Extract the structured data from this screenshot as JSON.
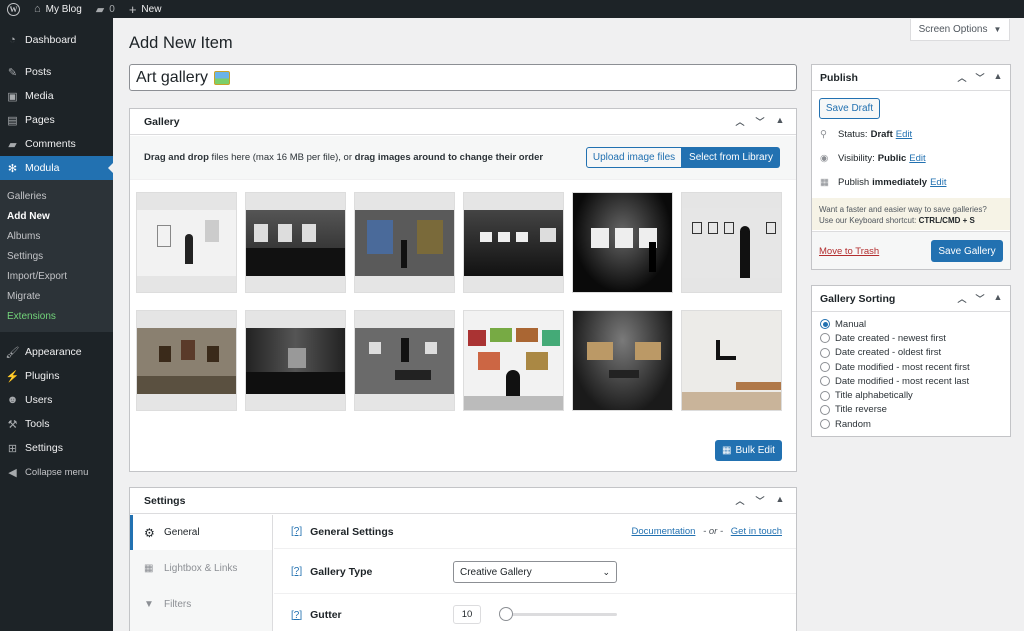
{
  "adminbar": {
    "site_name": "My Blog",
    "comments_count": "0",
    "new_label": "New"
  },
  "sidebar": {
    "top_items": [
      {
        "label": "Dashboard"
      },
      {
        "label": "Posts"
      },
      {
        "label": "Media"
      },
      {
        "label": "Pages"
      },
      {
        "label": "Comments"
      }
    ],
    "current": {
      "label": "Modula"
    },
    "submenu": [
      "Galleries",
      "Add New",
      "Albums",
      "Settings",
      "Import/Export",
      "Migrate",
      "Extensions"
    ],
    "bottom_items": [
      {
        "label": "Appearance"
      },
      {
        "label": "Plugins"
      },
      {
        "label": "Users"
      },
      {
        "label": "Tools"
      },
      {
        "label": "Settings"
      }
    ],
    "collapse_label": "Collapse menu"
  },
  "screen_options": "Screen Options",
  "page_title": "Add New Item",
  "post_title": "Art gallery",
  "gallery_box": {
    "title": "Gallery",
    "drag_bold": "Drag and drop",
    "drag_text": " files here (max 16 MB per file), or ",
    "drag_bold2": "drag images around to change their order",
    "upload_label": "Upload image files",
    "library_label": "Select from Library",
    "bulk_edit_label": "Bulk Edit"
  },
  "publish_box": {
    "title": "Publish",
    "save_draft": "Save Draft",
    "status_label": "Status:",
    "status_value": "Draft",
    "visibility_label": "Visibility:",
    "visibility_value": "Public",
    "publish_label": "Publish",
    "publish_value": "immediately",
    "edit_label": "Edit",
    "tip_line1": "Want a faster and easier way to save galleries?",
    "tip_line2": "Use our Keyboard shortcut:",
    "tip_shortcut": "CTRL/CMD + S",
    "trash_label": "Move to Trash",
    "save_gallery": "Save Gallery"
  },
  "sorting_box": {
    "title": "Gallery Sorting",
    "options": [
      "Manual",
      "Date created - newest first",
      "Date created - oldest first",
      "Date modified - most recent first",
      "Date modified - most recent last",
      "Title alphabetically",
      "Title reverse",
      "Random"
    ],
    "selected_index": 0
  },
  "settings_box": {
    "title": "Settings",
    "tabs": [
      "General",
      "Lightbox & Links",
      "Filters"
    ],
    "active_tab": "General",
    "help_marker": "[?]",
    "section_title": "General Settings",
    "documentation": "Documentation",
    "or_text": "- or -",
    "get_in_touch": "Get in touch",
    "gallery_type_label": "Gallery Type",
    "gallery_type_value": "Creative Gallery",
    "gutter_label": "Gutter",
    "gutter_value": "10"
  },
  "colors": {
    "accent": "#2271b1",
    "sidebar_bg": "#1d2327",
    "extensions_green": "#72d47a"
  }
}
